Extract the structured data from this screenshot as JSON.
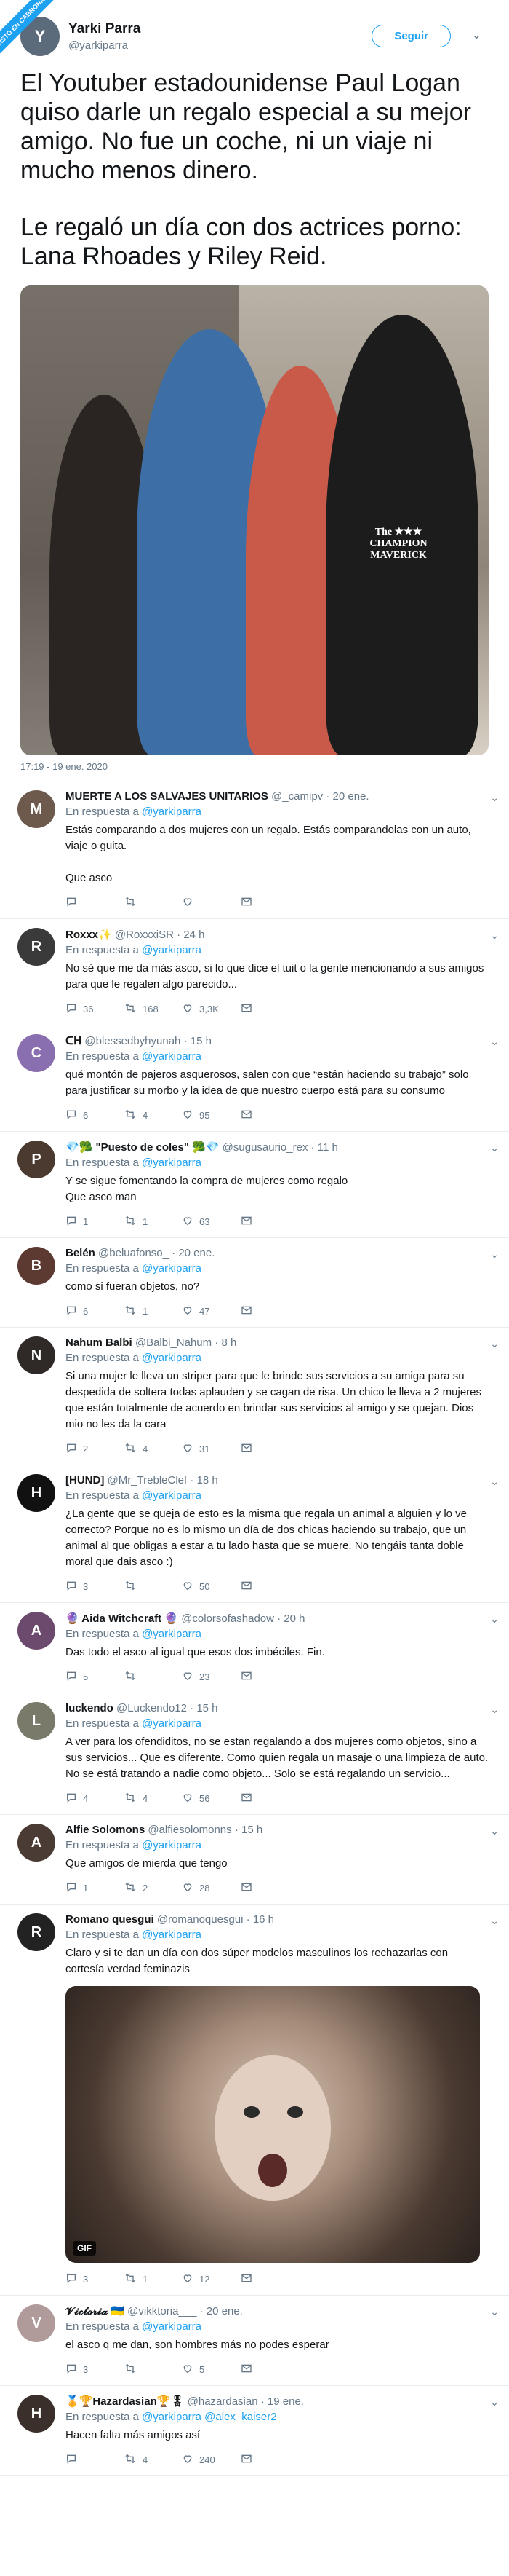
{
  "ribbon": "VISTO EN CABRONAZI",
  "tweet": {
    "author_name": "Yarki Parra",
    "author_handle": "@yarkiparra",
    "avatar_initial": "Y",
    "follow_label": "Seguir",
    "paragraphs": [
      "El Youtuber estadounidense Paul Logan quiso darle un regalo especial a su mejor amigo. No fue un coche, ni un viaje ni mucho menos dinero.",
      "Le regaló un día con dos actrices porno: Lana Rhoades y Riley Reid."
    ],
    "photo_shirt_text": "The ★★★ CHAMPION MAVERICK",
    "timestamp": "17:19 - 19 ene. 2020"
  },
  "colors": {
    "accent": "#1da1f2",
    "muted": "#657786",
    "border": "#e6ecf0"
  },
  "in_reply_label": "En respuesta a",
  "replies": [
    {
      "name": "MUERTE A LOS SALVAJES UNITARIOS",
      "handle": "@_camipv",
      "date": "· 20 ene.",
      "mentions": "@yarkiparra",
      "text": "Estás comparando a dos mujeres con un regalo. Estás comparandolas con un auto, viaje o guita.\n\nQue asco",
      "replies": "",
      "retweets": "",
      "likes": "",
      "avatar_color": "#6e5a4d",
      "initial": "M"
    },
    {
      "name": "Roxxx✨",
      "handle": "@RoxxxiSR",
      "date": "· 24 h",
      "mentions": "@yarkiparra",
      "text": "No sé que me da más asco, si lo que dice el tuit o la gente mencionando a sus amigos para que le regalen algo parecido...",
      "replies": "36",
      "retweets": "168",
      "likes": "3,3K",
      "avatar_color": "#3a3a3a",
      "initial": "R"
    },
    {
      "name": "ᑕᕼ",
      "handle": "@blessedbyhyunah",
      "date": "· 15 h",
      "mentions": "@yarkiparra",
      "text": "qué montón de pajeros asquerosos, salen con que “están haciendo su trabajo” solo para justificar su morbo y la idea de que nuestro cuerpo está para su consumo",
      "replies": "6",
      "retweets": "4",
      "likes": "95",
      "avatar_color": "#8a6fb0",
      "initial": "C"
    },
    {
      "name": "💎🥦 \"Puesto de coles\" 🥦💎",
      "handle": "@sugusaurio_rex",
      "date": "· 11 h",
      "mentions": "@yarkiparra",
      "text": "Y se sigue fomentando la compra de mujeres como regalo\nQue asco man",
      "replies": "1",
      "retweets": "1",
      "likes": "63",
      "avatar_color": "#4b3a30",
      "initial": "P"
    },
    {
      "name": "Belén",
      "handle": "@beluafonso_",
      "date": "· 20 ene.",
      "mentions": "@yarkiparra",
      "text": "como si fueran objetos, no?",
      "replies": "6",
      "retweets": "1",
      "likes": "47",
      "avatar_color": "#5c3a32",
      "initial": "B"
    },
    {
      "name": "Nahum Balbi",
      "handle": "@Balbi_Nahum",
      "date": "· 8 h",
      "mentions": "@yarkiparra",
      "text": "Si una mujer le lleva un striper para que le brinde sus servicios a su amiga para su despedida de soltera todas aplauden y se cagan de risa. Un chico le lleva a 2 mujeres que están totalmente de acuerdo en brindar sus servicios al amigo y se quejan. Dios mio no les da la cara",
      "replies": "2",
      "retweets": "4",
      "likes": "31",
      "avatar_color": "#2f2a28",
      "initial": "N"
    },
    {
      "name": "[HUND]",
      "handle": "@Mr_TrebleClef",
      "date": "· 18 h",
      "mentions": "@yarkiparra",
      "text": "¿La gente que se queja de esto es la misma que regala un animal a alguien y lo ve correcto? Porque no es lo mismo un día de dos chicas haciendo su trabajo, que un animal al que obligas a estar a tu lado hasta que se muere. No tengáis tanta doble moral que dais asco :)",
      "replies": "3",
      "retweets": "",
      "likes": "50",
      "avatar_color": "#111111",
      "initial": "H"
    },
    {
      "name": "🔮 Aida Witchcraft 🔮",
      "handle": "@colorsofashadow",
      "date": "· 20 h",
      "mentions": "@yarkiparra",
      "text": "Das todo el asco al igual que esos dos imbéciles. Fin.",
      "replies": "5",
      "retweets": "",
      "likes": "23",
      "avatar_color": "#6b4a6e",
      "initial": "A"
    },
    {
      "name": "luckendo",
      "handle": "@Luckendo12",
      "date": "· 15 h",
      "mentions": "@yarkiparra",
      "text": "A ver para los ofendiditos, no se estan regalando a dos mujeres como objetos, sino a sus servicios... Que es diferente. Como quien regala un masaje o una limpieza de auto. No se está tratando a nadie como objeto... Solo se está regalando un servicio...",
      "replies": "4",
      "retweets": "4",
      "likes": "56",
      "avatar_color": "#7a7a6a",
      "initial": "L"
    },
    {
      "name": "Alfie Solomons",
      "handle": "@alfiesolomonns",
      "date": "· 15 h",
      "mentions": "@yarkiparra",
      "text": "Que amigos de mierda que tengo",
      "replies": "1",
      "retweets": "2",
      "likes": "28",
      "avatar_color": "#4a3b34",
      "initial": "A"
    },
    {
      "name": "Romano quesgui",
      "handle": "@romanoquesgui",
      "date": "· 16 h",
      "mentions": "@yarkiparra",
      "text": "Claro y si te dan un día con dos súper modelos masculinos los rechazarlas con cortesía verdad feminazis",
      "replies": "3",
      "retweets": "1",
      "likes": "12",
      "avatar_color": "#222222",
      "initial": "R",
      "gif_label": "GIF"
    },
    {
      "name": "𝓥𝓲𝓬𝓽𝓸𝓻𝓲𝓪 🇺🇦",
      "handle": "@vikktoria___",
      "date": "· 20 ene.",
      "mentions": "@yarkiparra",
      "text": "el asco q me dan, son hombres más no podes esperar",
      "replies": "3",
      "retweets": "",
      "likes": "5",
      "avatar_color": "#b09a9a",
      "initial": "V"
    },
    {
      "name": "🏅🏆Hazardasian🏆🎖",
      "handle": "@hazardasian",
      "date": "· 19 ene.",
      "mentions": "@yarkiparra @alex_kaiser2",
      "text": "Hacen falta más amigos así",
      "replies": "",
      "retweets": "4",
      "likes": "240",
      "avatar_color": "#3a2f2a",
      "initial": "H"
    }
  ]
}
